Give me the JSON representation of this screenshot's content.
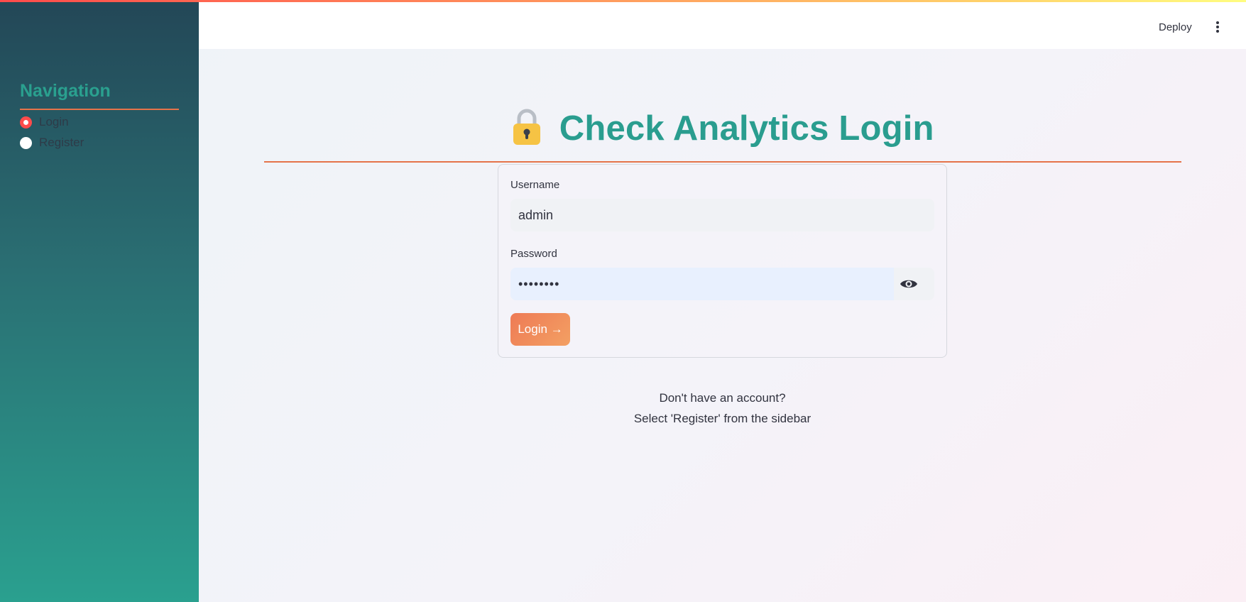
{
  "sidebar": {
    "title": "Navigation",
    "options": [
      {
        "label": "Login",
        "selected": true
      },
      {
        "label": "Register",
        "selected": false
      }
    ]
  },
  "header": {
    "deploy_label": "Deploy",
    "menu_icon": "kebab-menu-icon"
  },
  "main": {
    "title_icon": "lock-icon",
    "title": "Check Analytics Login",
    "form": {
      "username_label": "Username",
      "username_value": "admin",
      "password_label": "Password",
      "password_value": "••••••••",
      "password_toggle_icon": "eye-icon",
      "login_label": "Login →"
    },
    "footer": {
      "line1": "Don't have an account?",
      "line2": "Select 'Register' from the sidebar"
    }
  },
  "colors": {
    "accent": "#2a9d8f",
    "button": "#ee7a55",
    "rule": "#e5734a",
    "radio_selected": "#ff4b4b"
  }
}
